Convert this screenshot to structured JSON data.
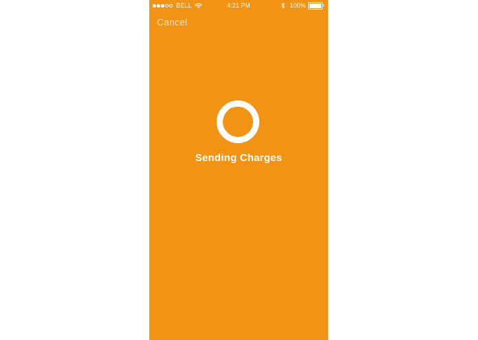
{
  "status_bar": {
    "carrier": "BELL",
    "time": "4:21 PM",
    "battery": "100%",
    "battery_level": 1.0,
    "signal_bars_filled": 3,
    "signal_bars_total": 5
  },
  "nav": {
    "cancel_label": "Cancel"
  },
  "loading": {
    "message": "Sending Charges"
  },
  "icons": {
    "wifi": "wifi-icon",
    "bluetooth": "bluetooth-icon",
    "battery": "battery-icon",
    "spinner": "loading-spinner-icon"
  },
  "colors": {
    "background": "#f29313",
    "foreground": "#ffffff",
    "cancel_text": "#fbe0b8"
  }
}
